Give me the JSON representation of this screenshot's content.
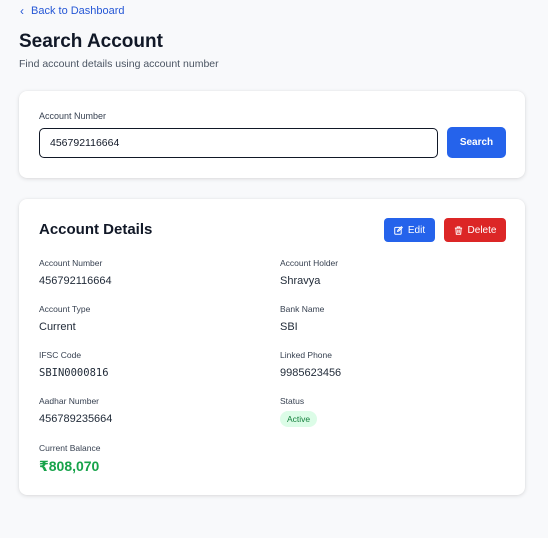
{
  "nav": {
    "back_label": "Back to Dashboard"
  },
  "header": {
    "title": "Search Account",
    "subtitle": "Find account details using account number"
  },
  "search": {
    "label": "Account Number",
    "value": "456792116664",
    "button_label": "Search"
  },
  "details": {
    "title": "Account Details",
    "edit_label": "Edit",
    "delete_label": "Delete",
    "fields": {
      "account_number": {
        "label": "Account Number",
        "value": "456792116664"
      },
      "account_holder": {
        "label": "Account Holder",
        "value": "Shravya"
      },
      "account_type": {
        "label": "Account Type",
        "value": "Current"
      },
      "bank_name": {
        "label": "Bank Name",
        "value": "SBI"
      },
      "ifsc_code": {
        "label": "IFSC Code",
        "value": "SBIN0000816"
      },
      "linked_phone": {
        "label": "Linked Phone",
        "value": "9985623456"
      },
      "aadhar_number": {
        "label": "Aadhar Number",
        "value": "456789235664"
      },
      "status": {
        "label": "Status",
        "value": "Active"
      },
      "current_balance": {
        "label": "Current Balance",
        "value": "₹808,070"
      }
    }
  },
  "colors": {
    "primary": "#2563eb",
    "danger": "#dc2626",
    "success": "#16a34a",
    "badge_bg": "#dcfce7"
  },
  "icons": {
    "back": "chevron-left-icon",
    "edit": "edit-icon",
    "delete": "trash-icon"
  }
}
